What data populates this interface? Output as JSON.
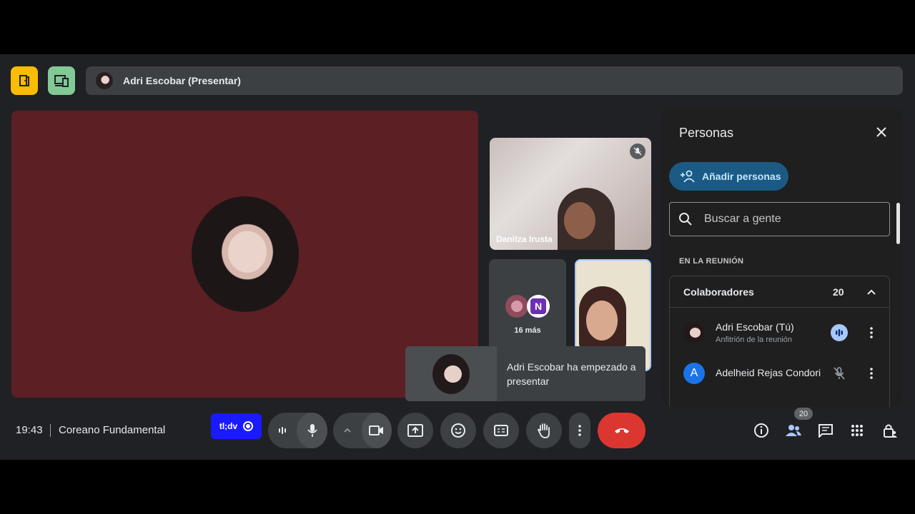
{
  "colors": {
    "accent_yellow": "#fbbc04",
    "accent_green": "#81c995",
    "hangup_red": "#dc3630",
    "tldv_blue": "#1a1aff",
    "stage_bg": "#5c1f24"
  },
  "top_bar": {
    "presenting_label": "Adri Escobar (Presentar)",
    "icons": [
      "door-icon",
      "devices-icon"
    ]
  },
  "stage": {
    "presenter": "Adri Escobar"
  },
  "tiles": {
    "danitza": {
      "name": "Danitza Irusta",
      "muted": true
    },
    "more": {
      "label": "16 más",
      "avatar_letter": "N"
    }
  },
  "toast": {
    "message": "Adri Escobar ha empezado a presentar"
  },
  "people_panel": {
    "title": "Personas",
    "add_label": "Añadir personas",
    "search_placeholder": "Buscar a gente",
    "section_label": "EN LA REUNIÓN",
    "group": {
      "name": "Colaboradores",
      "count": "20"
    },
    "members": [
      {
        "name": "Adri Escobar (Tú)",
        "subtitle": "Anfitrión de la reunión",
        "status": "speaking"
      },
      {
        "name": "Adelheid Rejas Condori",
        "initial": "A",
        "status": "muted"
      }
    ]
  },
  "bottom_bar": {
    "time": "19:43",
    "meeting_name": "Coreano Fundamental",
    "tldv_label": "tl;dv",
    "participants_badge": "20"
  }
}
